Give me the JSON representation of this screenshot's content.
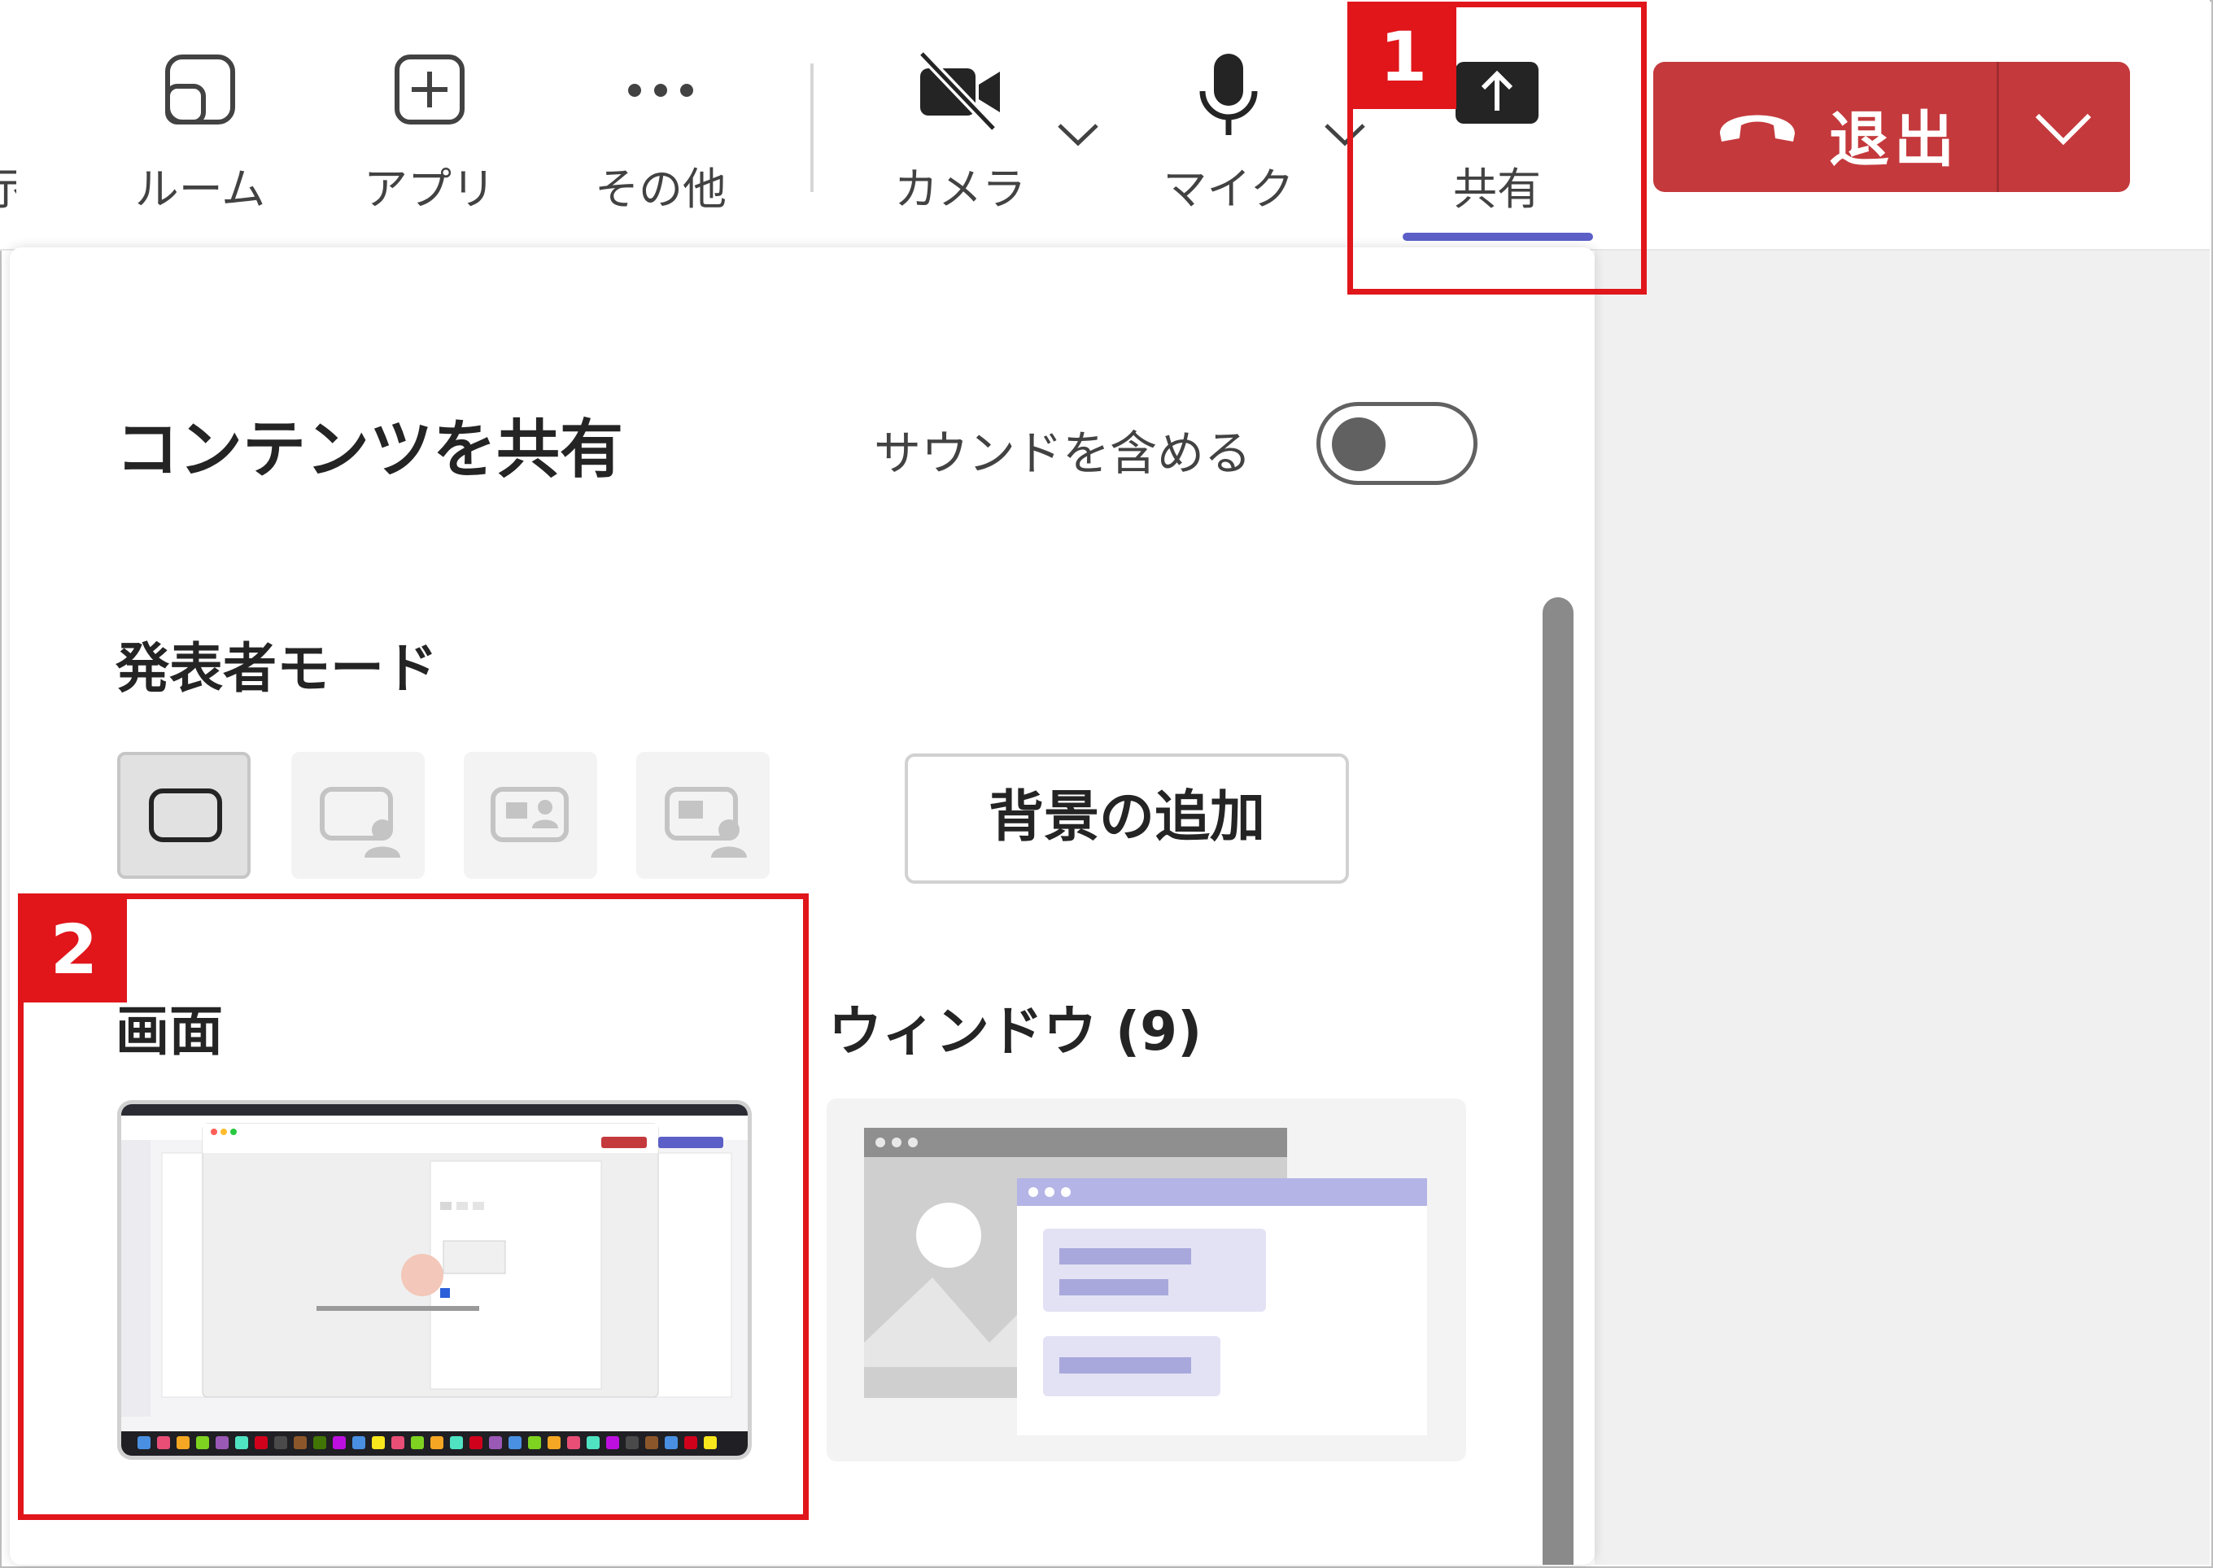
{
  "toolbar": {
    "items": [
      {
        "label": "ルーム",
        "icon": "rooms-icon"
      },
      {
        "label": "アプリ",
        "icon": "add-app-icon"
      },
      {
        "label": "その他",
        "icon": "more-icon"
      },
      {
        "label": "カメラ",
        "icon": "camera-off-icon"
      },
      {
        "label": "マイク",
        "icon": "microphone-icon"
      },
      {
        "label": "共有",
        "icon": "share-icon"
      }
    ],
    "partial_left_label": "示",
    "leave_label": "退出"
  },
  "share_panel": {
    "title": "コンテンツを共有",
    "sound_label": "サウンドを含める",
    "sound_enabled": false,
    "presenter_mode_title": "発表者モード",
    "add_background_label": "背景の追加",
    "screen_title": "画面",
    "window_title": "ウィンドウ (9)"
  },
  "annotations": [
    {
      "number": "1"
    },
    {
      "number": "2"
    }
  ],
  "colors": {
    "accent": "#5b5fc7",
    "leave": "#c4393c",
    "annotation": "#e0161b"
  }
}
